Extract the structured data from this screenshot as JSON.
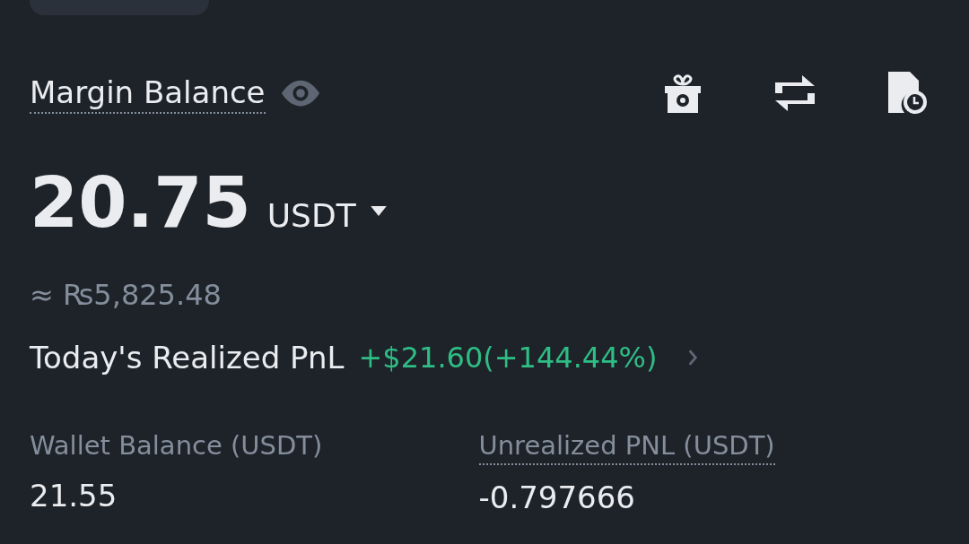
{
  "header": {
    "title": "Margin Balance",
    "dotted": true
  },
  "balance": {
    "amount": "20.75",
    "currency": "USDT"
  },
  "fiat_estimate": "≈ ₨5,825.48",
  "pnl": {
    "label": "Today's Realized PnL",
    "value": "+$21.60(+144.44%)",
    "color": "#2ebd85"
  },
  "stats": [
    {
      "label": "Wallet Balance (USDT)",
      "value": "21.55",
      "dotted": false
    },
    {
      "label": "Unrealized PNL (USDT)",
      "value": "-0.797666",
      "dotted": true
    }
  ]
}
